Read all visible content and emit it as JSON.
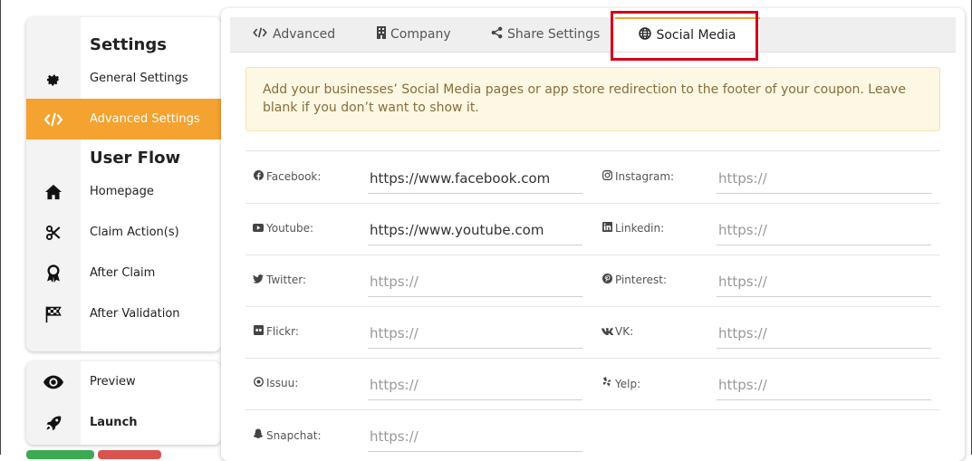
{
  "sidebar": {
    "settings_title": "Settings",
    "general_settings": "General Settings",
    "advanced_settings": "Advanced Settings",
    "user_flow_title": "User Flow",
    "homepage": "Homepage",
    "claim_actions": "Claim Action(s)",
    "after_claim": "After Claim",
    "after_validation": "After Validation"
  },
  "sidebar2": {
    "preview": "Preview",
    "launch": "Launch"
  },
  "tabs": {
    "advanced": "Advanced",
    "company": "Company",
    "share_settings": "Share Settings",
    "social_media": "Social Media",
    "active": "Social Media"
  },
  "notice": "Add your businesses’ Social Media pages or app store redirection to the footer of your coupon. Leave blank if you don’t want to show it.",
  "fields": {
    "facebook": {
      "label": "Facebook:",
      "value": "https://www.facebook.com",
      "placeholder": "https://"
    },
    "instagram": {
      "label": "Instagram:",
      "value": "",
      "placeholder": "https://"
    },
    "youtube": {
      "label": "Youtube:",
      "value": "https://www.youtube.com",
      "placeholder": "https://"
    },
    "linkedin": {
      "label": "Linkedin:",
      "value": "",
      "placeholder": "https://"
    },
    "twitter": {
      "label": "Twitter:",
      "value": "",
      "placeholder": "https://"
    },
    "pinterest": {
      "label": "Pinterest:",
      "value": "",
      "placeholder": "https://"
    },
    "flickr": {
      "label": "Flickr:",
      "value": "",
      "placeholder": "https://"
    },
    "vk": {
      "label": "VK:",
      "value": "",
      "placeholder": "https://"
    },
    "issuu": {
      "label": "Issuu:",
      "value": "",
      "placeholder": "https://"
    },
    "yelp": {
      "label": "Yelp:",
      "value": "",
      "placeholder": "https://"
    },
    "snapchat": {
      "label": "Snapchat:",
      "value": "",
      "placeholder": "https://"
    }
  },
  "colors": {
    "accent": "#f4a230",
    "highlight": "#d0021b",
    "notice_bg": "#fcf8e3",
    "notice_text": "#8a6d3b"
  },
  "icons": {
    "general_settings": "gear-icon",
    "advanced_settings": "code-icon",
    "homepage": "home-icon",
    "claim_actions": "scissors-icon",
    "after_claim": "award-icon",
    "after_validation": "checkered-flag-icon",
    "preview": "eye-icon",
    "launch": "rocket-icon"
  }
}
